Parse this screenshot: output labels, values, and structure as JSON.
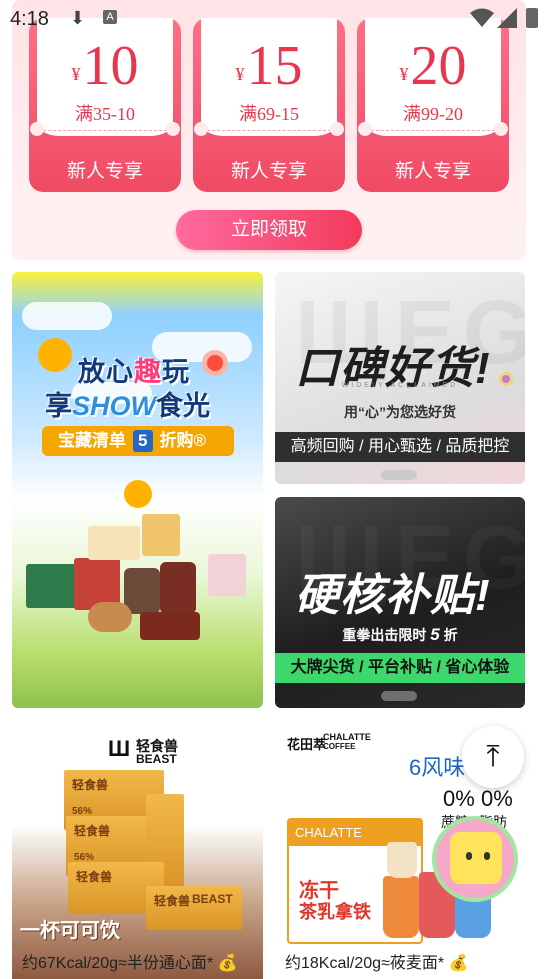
{
  "status_bar": {
    "time": "4:18"
  },
  "coupons": [
    {
      "currency": "¥",
      "amount": "10",
      "condition": "满35-10",
      "label": "新人专享"
    },
    {
      "currency": "¥",
      "amount": "15",
      "condition": "满69-15",
      "label": "新人专享"
    },
    {
      "currency": "¥",
      "amount": "20",
      "condition": "满99-20",
      "label": "新人专享"
    }
  ],
  "claim_button": "立即领取",
  "promo_left": {
    "title_a": "放心",
    "title_hl": "趣",
    "title_b": "玩",
    "title2_a": "享",
    "title2_show": "SHOW",
    "title2_b": "食光",
    "pill_a": "宝藏清单",
    "pill_num": "5",
    "pill_b": "折购®"
  },
  "promo_top_right": {
    "headline": "口碑好货!",
    "tagline_small": "WIDELY ACCLAIMED",
    "sub": "用“心”为您选好货",
    "band": "高频回购 / 用心甄选 / 品质把控"
  },
  "promo_bottom_right": {
    "headline": "硬核补贴!",
    "sub_a": "重拳出击限时",
    "sub_num": "5",
    "sub_b": "折",
    "band": "大牌尖货 / 平台补贴 / 省心体验"
  },
  "products": [
    {
      "brand": "轻食兽",
      "brand_en": "BEAST",
      "box_label": "轻食兽",
      "percent": "56%",
      "slogan": "一杯可可饮",
      "caption": "约67Kcal/20g≈半份通心面*"
    },
    {
      "brand": "花田萃",
      "brand_en": "CHALATTE",
      "brand_en2": "COFFEE",
      "flavor": "6风味",
      "zero_a": "0%",
      "zero_b": "0%",
      "zero_a_label": "蔗糖",
      "zero_b_label": "脂肪",
      "box_title": "CHALATTE",
      "box_sub": "冻干",
      "box_sub2": "茶乳拿铁",
      "caption": "约18Kcal/20g≈莜麦面*"
    }
  ],
  "colors": {
    "accent": "#f04a64",
    "coupon_text": "#e9364f",
    "band_dark": "#2f2f2f",
    "band_green": "#3dd86b"
  }
}
